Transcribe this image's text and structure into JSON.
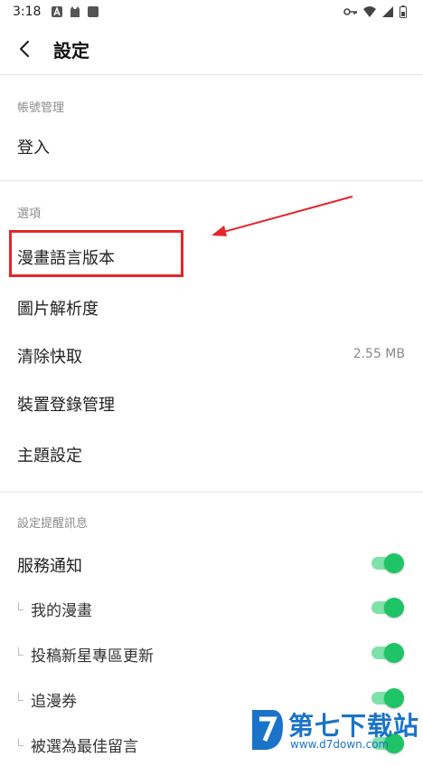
{
  "status": {
    "time": "3:18",
    "left_icons": [
      "a-notification-icon",
      "cat-notification-icon",
      "square-notification-icon"
    ],
    "right_icons": [
      "key-icon",
      "wifi-icon",
      "signal-icon",
      "battery-icon"
    ]
  },
  "header": {
    "title": "設定"
  },
  "sections": {
    "account": {
      "title": "帳號管理",
      "login": "登入"
    },
    "options": {
      "title": "選項",
      "comic_language": "漫畫語言版本",
      "image_resolution": "圖片解析度",
      "clear_cache": "清除快取",
      "cache_size": "2.55 MB",
      "device_login": "裝置登錄管理",
      "theme": "主題設定"
    },
    "notifications": {
      "title": "設定提醒訊息",
      "items": [
        {
          "label": "服務通知",
          "enabled": true
        },
        {
          "label": "我的漫畫",
          "enabled": true
        },
        {
          "label": "投稿新星專區更新",
          "enabled": true
        },
        {
          "label": "追漫券",
          "enabled": true
        },
        {
          "label": "被選為最佳留言",
          "enabled": true
        }
      ]
    }
  },
  "colors": {
    "toggle_on": "#1ec465",
    "highlight": "#e5262b",
    "watermark": "#1a73c8"
  },
  "watermark": {
    "brand": "第七下载站",
    "url": "www.d7down.com"
  }
}
